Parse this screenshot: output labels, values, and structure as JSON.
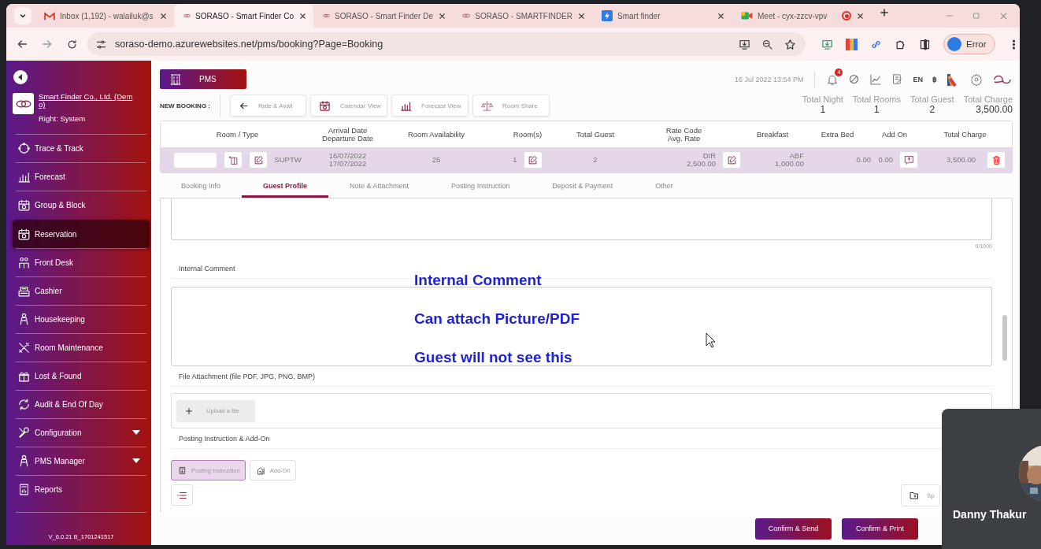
{
  "browser": {
    "tabs": [
      {
        "title": "Inbox (1,192) - walailuk@s",
        "kind": "mail",
        "selected": false,
        "recording": false
      },
      {
        "title": "SORASO - Smart Finder Co",
        "kind": "soraso",
        "selected": true,
        "recording": false
      },
      {
        "title": "SORASO - Smart Finder De",
        "kind": "soraso",
        "selected": false,
        "recording": false
      },
      {
        "title": "SORASO - SMARTFINDER",
        "kind": "soraso",
        "selected": false,
        "recording": false
      },
      {
        "title": "Smart finder",
        "kind": "doc",
        "selected": false,
        "recording": false
      },
      {
        "title": "Meet - cyx-zzcv-vpv",
        "kind": "meet",
        "selected": false,
        "recording": true
      }
    ],
    "url": "soraso-demo.azurewebsites.net/pms/booking?Page=Booking",
    "profile": "Error"
  },
  "sidebar": {
    "company": "Smart Finder Co., Ltd. (Demo)",
    "right": "Right: System",
    "items": [
      {
        "label": "Trace & Track",
        "selected": false,
        "expandable": false
      },
      {
        "label": "Forecast",
        "selected": false,
        "expandable": false
      },
      {
        "label": "Group & Block",
        "selected": false,
        "expandable": false
      },
      {
        "label": "Reservation",
        "selected": true,
        "expandable": false
      },
      {
        "label": "Front Desk",
        "selected": false,
        "expandable": false
      },
      {
        "label": "Cashier",
        "selected": false,
        "expandable": false
      },
      {
        "label": "Housekeeping",
        "selected": false,
        "expandable": false
      },
      {
        "label": "Room Maintenance",
        "selected": false,
        "expandable": false
      },
      {
        "label": "Lost & Found",
        "selected": false,
        "expandable": false
      },
      {
        "label": "Audit & End Of Day",
        "selected": false,
        "expandable": false
      },
      {
        "label": "Configuration",
        "selected": false,
        "expandable": true
      },
      {
        "label": "PMS Manager",
        "selected": false,
        "expandable": true
      },
      {
        "label": "Reports",
        "selected": false,
        "expandable": false
      }
    ],
    "version": "V_6.0.21 B_1701241517"
  },
  "header": {
    "module": "PMS",
    "datetime": "16 Jul 2022  13:54 PM",
    "notifications": "4",
    "language": "EN",
    "currency": "฿"
  },
  "booking": {
    "label": "NEW BOOKING :",
    "actions": [
      "Rate & Avail",
      "Calendar View",
      "Forecast View",
      "Room Share"
    ],
    "totals": [
      {
        "label": "Total Night",
        "value": "1"
      },
      {
        "label": "Total Rooms",
        "value": "1"
      },
      {
        "label": "Total Guest",
        "value": "2"
      },
      {
        "label": "Total Charge",
        "value": "3,500.00"
      }
    ]
  },
  "table": {
    "columns": [
      "Room / Type",
      "Arrival Date\nDeparture Date",
      "Room Availability",
      "Room(s)",
      "Total Guest",
      "Rate Code\nAvg. Rate",
      "Breakfast",
      "Extra Bed",
      "Add On",
      "Total Charge"
    ],
    "row": {
      "room_type": "SUPTW",
      "dates": "16/07/2022\n17/07/2022",
      "availability": "25",
      "rooms": "1",
      "guests": "2",
      "rate": "DIR\n2,500.00",
      "breakfast": "ABF\n1,000.00",
      "extra_bed": "0.00",
      "add_on": "0.00",
      "total": "3,500.00"
    }
  },
  "detail_tabs": [
    {
      "label": "Booking Info",
      "selected": false
    },
    {
      "label": "Guest Profile",
      "selected": true
    },
    {
      "label": "Note & Attachment",
      "selected": false
    },
    {
      "label": "Posting Instruction",
      "selected": false
    },
    {
      "label": "Deposit & Payment",
      "selected": false
    },
    {
      "label": "Other",
      "selected": false
    }
  ],
  "form": {
    "char_count": "0/1000",
    "internal_comment": "Internal Comment",
    "file_attachment": "File Attachment (file PDF, JPG, PNG, BMP)",
    "upload": "Upload a file",
    "posting_heading": "Posting Instruction & Add-On",
    "posting_tabs": [
      {
        "label": "Posting Instruction",
        "selected": true
      },
      {
        "label": "Add-On",
        "selected": false
      }
    ],
    "side_button": "Sp"
  },
  "footer": [
    "Confirm & Send",
    "Confirm & Print"
  ],
  "annotation": [
    "Internal Comment",
    "Can attach Picture/PDF",
    "Guest will not see this"
  ],
  "video": {
    "name": "Danny Thakur"
  }
}
